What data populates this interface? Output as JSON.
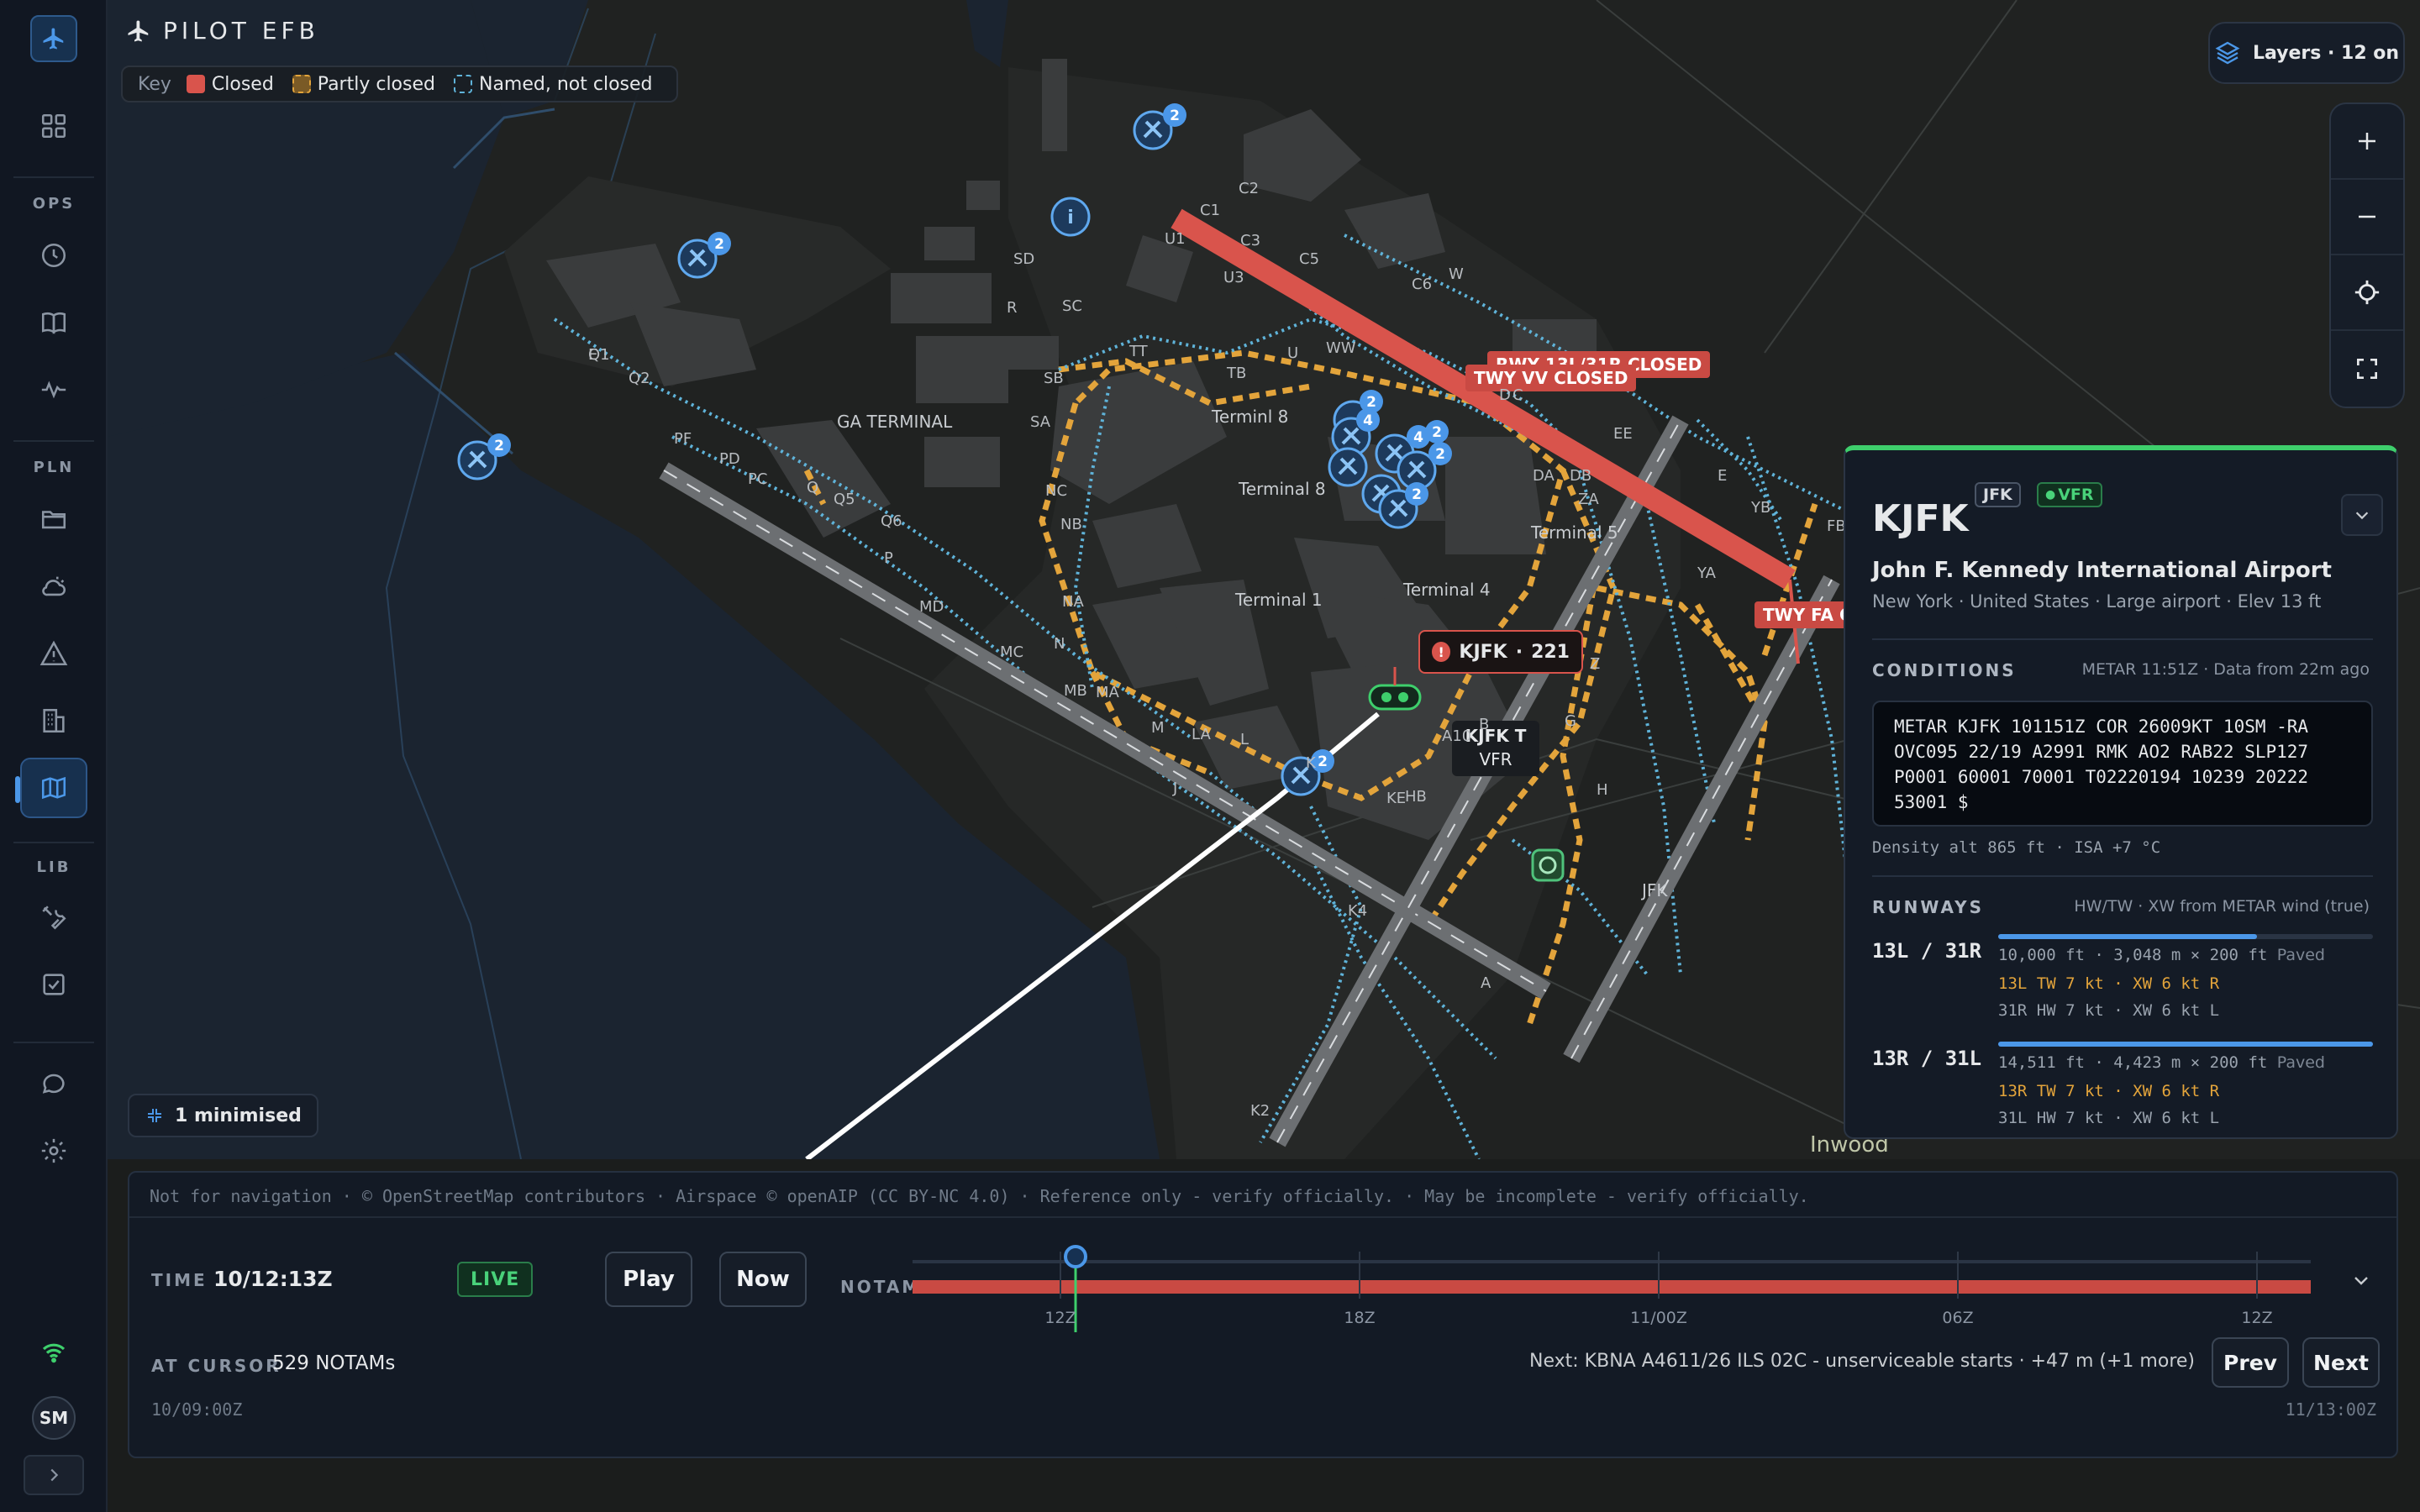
{
  "app": {
    "title": "PILOT EFB"
  },
  "sidebar": {
    "sections": {
      "ops": "OPS",
      "pln": "PLN",
      "lib": "LIB"
    },
    "avatar": "SM"
  },
  "map": {
    "key": {
      "label": "Key",
      "items": [
        {
          "label": "Closed",
          "color": "#d9544c"
        },
        {
          "label": "Partly closed",
          "color": "#e3a43b"
        },
        {
          "label": "Named, not closed",
          "color": "#5fb3d9"
        }
      ]
    },
    "layers_label": "Layers · 12 on",
    "minimised_label": "1 minimised",
    "closures": {
      "rwy": "RWY 13L/31R CLOSED",
      "twy_vv": "TWY VV CLOSED",
      "twy_fa": "TWY FA CLOSED"
    },
    "station_flag": {
      "ident": "KJFK",
      "count": "221"
    },
    "station_label": {
      "ident": "KJFK",
      "suffix": "T",
      "category": "VFR"
    },
    "airport_label": "JFK",
    "place_labels": {
      "terminal_8": "Terminl 8",
      "terminal_8b": "Terminal 8",
      "terminal_1": "Terminal 1",
      "terminal_4": "Terminal 4",
      "terminal_5": "Terminal 5",
      "ga_terminal": "GA TERMINAL",
      "inwood": "Inwood"
    },
    "taxiway_labels": [
      "Q1",
      "Q2",
      "PF",
      "PD",
      "PC",
      "Q",
      "Q5",
      "Q6",
      "MD",
      "MC",
      "MB",
      "MA",
      "M",
      "LA",
      "L",
      "K",
      "K2",
      "K4",
      "KE",
      "HB",
      "A10",
      "B",
      "G",
      "H",
      "Z",
      "ZA",
      "FB",
      "YA",
      "YB",
      "E",
      "EE",
      "DB",
      "DA",
      "D",
      "C",
      "C1",
      "C2",
      "C3",
      "C5",
      "C6",
      "W",
      "WW",
      "U",
      "U1",
      "U3",
      "TT",
      "TB",
      "SA",
      "SB",
      "SC",
      "SD",
      "R",
      "NC",
      "NB",
      "NA",
      "N",
      "P",
      "J",
      "A",
      "E"
    ],
    "clusters": [
      "2",
      "2",
      "2",
      "2",
      "2",
      "2",
      "4",
      "2",
      "4",
      "2",
      "2"
    ]
  },
  "panel": {
    "code": "KJFK",
    "tags": {
      "iata": "JFK",
      "flight_cat": "VFR"
    },
    "name": "John F. Kennedy International Airport",
    "subtitle": "New York · United States · Large airport · Elev 13 ft",
    "conditions": {
      "title": "CONDITIONS",
      "meta": "METAR 11:51Z · Data from 22m ago",
      "metar": "METAR KJFK 101151Z COR 26009KT 10SM -RA\nOVC095 22/19 A2991 RMK AO2 RAB22 SLP127\nP0001 60001 70001 T02220194 10239 20222\n53001 $",
      "density": "Density alt 865 ft · ISA +7 °C"
    },
    "runways": {
      "title": "RUNWAYS",
      "meta": "HW/TW · XW from METAR wind (true)",
      "items": [
        {
          "id": "13L / 31R",
          "dims": "10,000 ft · 3,048 m × 200 ft",
          "surface": "Paved",
          "length_fraction": 0.69,
          "wind_a": "13L  TW 7 kt · XW 6 kt R",
          "wind_b": "31R  HW 7 kt · XW 6 kt L"
        },
        {
          "id": "13R / 31L",
          "dims": "14,511 ft · 4,423 m × 200 ft",
          "surface": "Paved",
          "length_fraction": 1.0,
          "wind_a": "13R  TW 7 kt · XW 6 kt R",
          "wind_b": "31L  HW 7 kt · XW 6 kt L"
        }
      ]
    }
  },
  "timeline": {
    "attribution": "Not for navigation  ·  © OpenStreetMap contributors · Airspace © openAIP (CC BY-NC 4.0)  ·  Reference only - verify officially.  ·  May be incomplete - verify officially.",
    "time_label": "TIME",
    "time_value": "10/12:13Z",
    "live": "LIVE",
    "play": "Play",
    "now": "Now",
    "notam_label": "NOTAM",
    "ticks": [
      "12Z",
      "18Z",
      "11/00Z",
      "06Z",
      "12Z"
    ],
    "cursor_label": "AT CURSOR",
    "cursor_value": "529 NOTAMs",
    "next_text": "Next: KBNA A4611/26 ILS 02C - unserviceable starts · +47 m (+1 more)",
    "prev": "Prev",
    "next": "Next",
    "range_start": "10/09:00Z",
    "range_end": "11/13:00Z"
  },
  "colors": {
    "closed": "#d9544c",
    "partly_closed": "#e3a43b",
    "named": "#5fb3d9",
    "accent": "#4b97e8",
    "vfr": "#49d27a"
  }
}
